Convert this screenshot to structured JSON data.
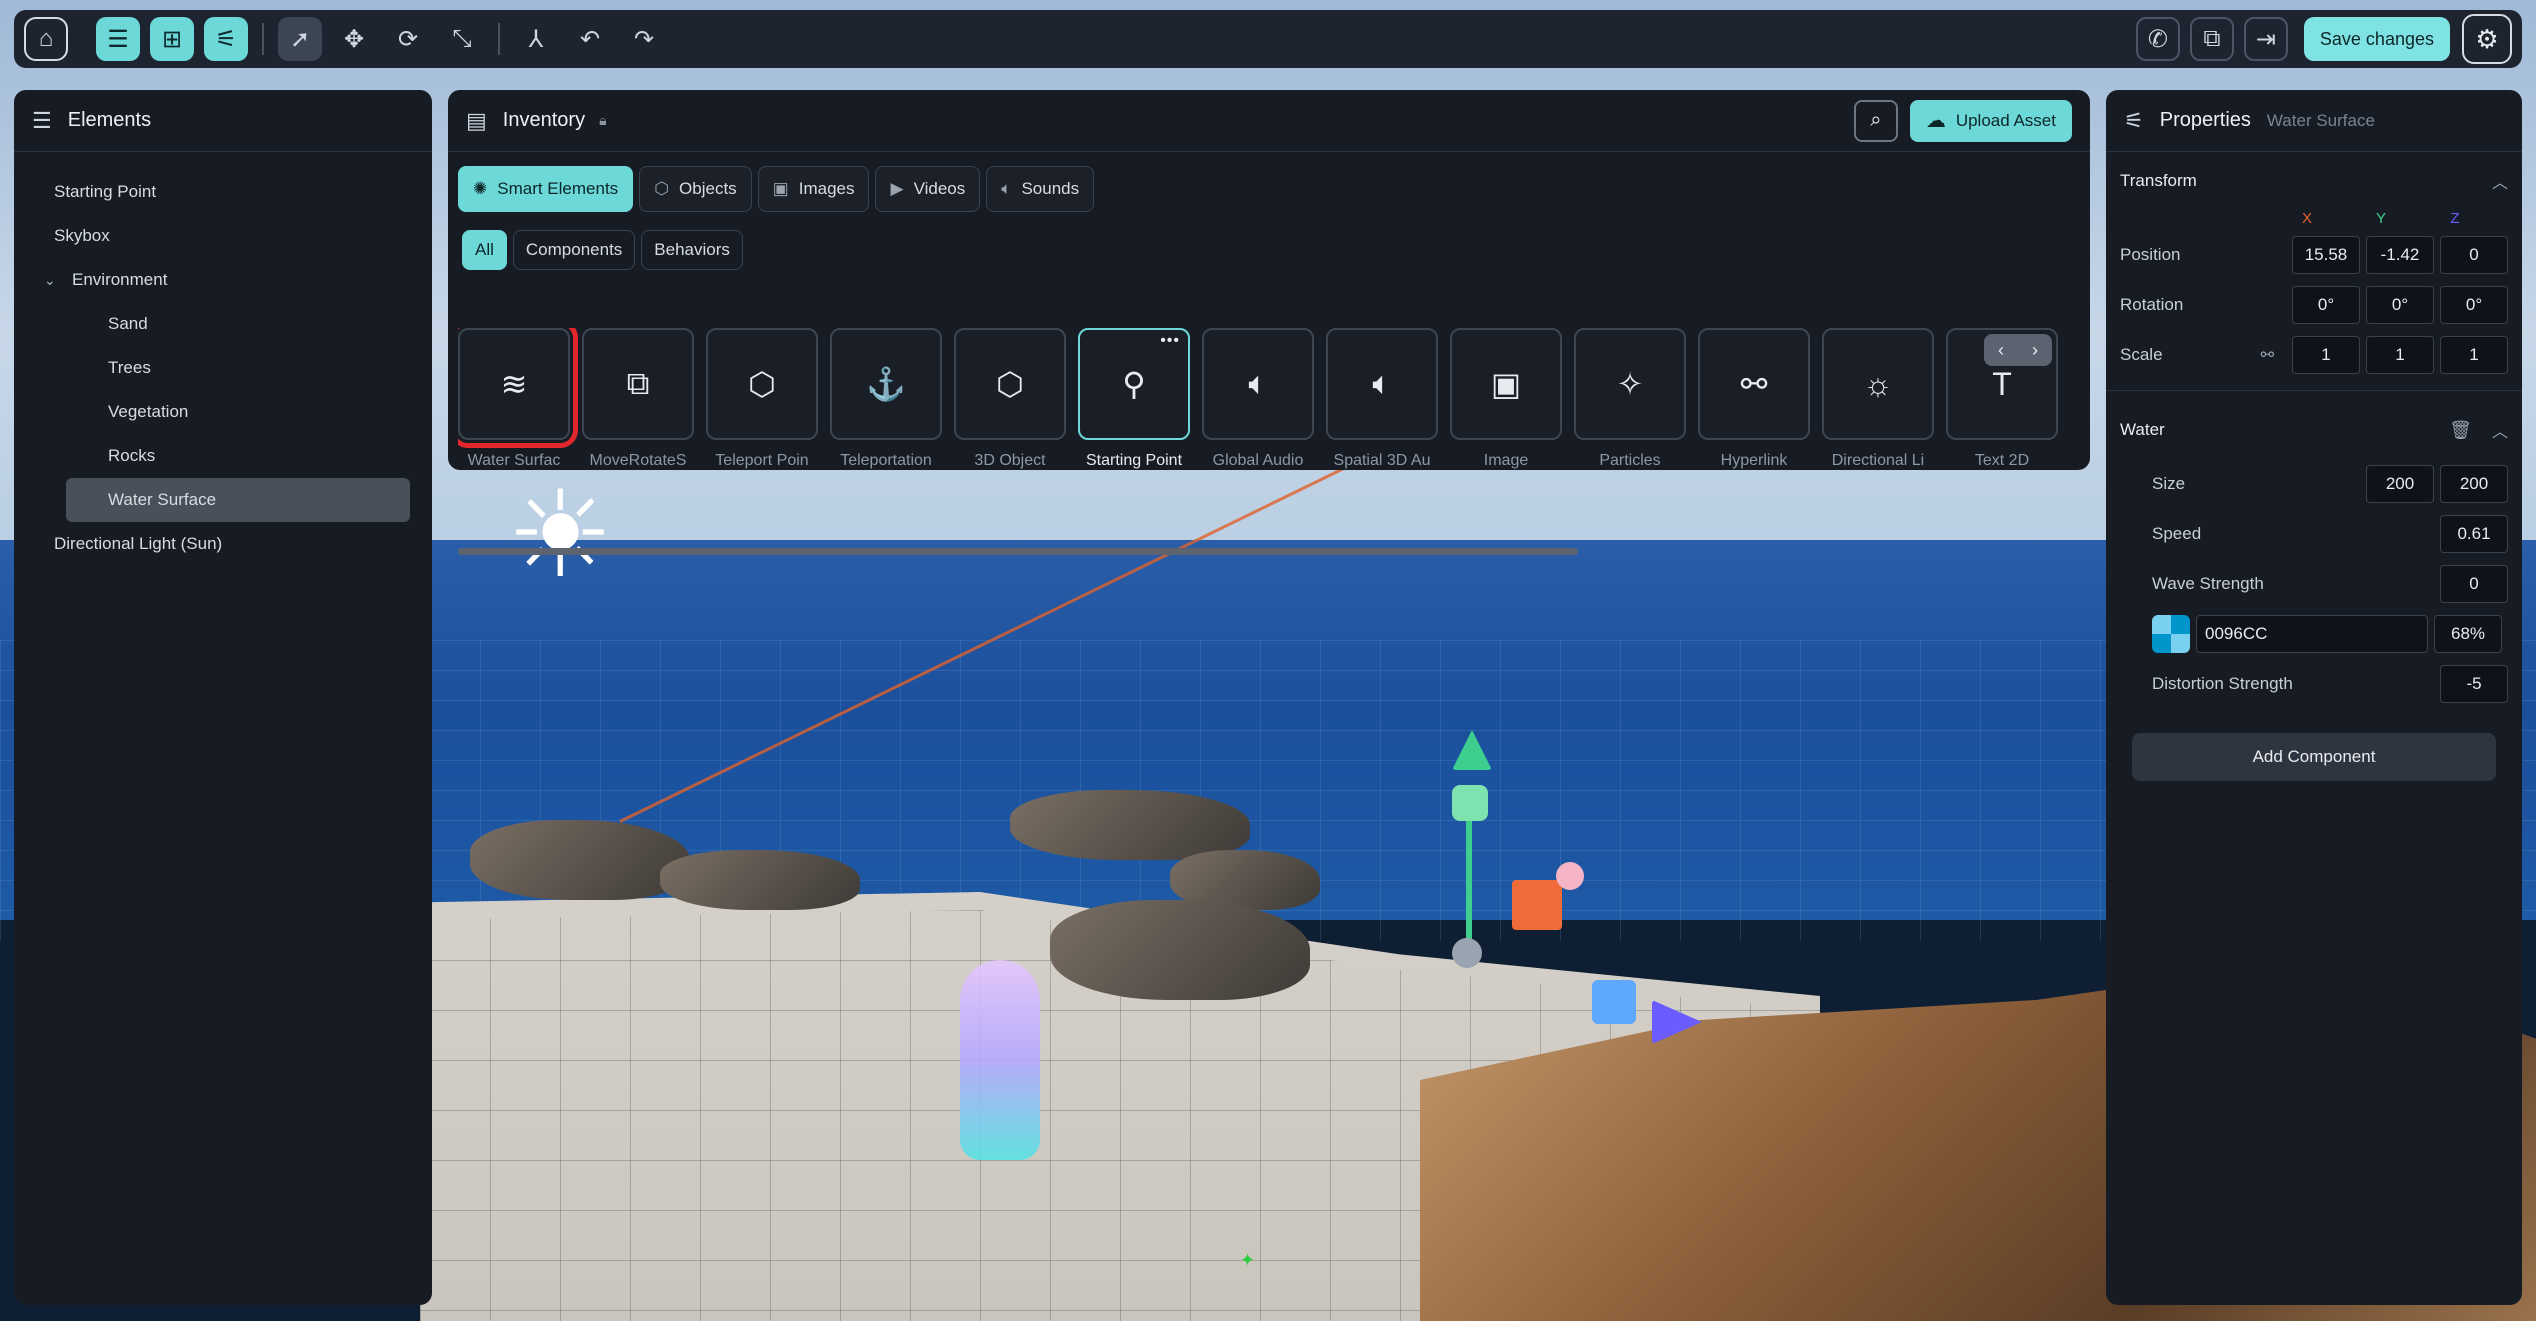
{
  "toolbar": {
    "save_label": "Save changes"
  },
  "elements_panel": {
    "title": "Elements",
    "items": [
      {
        "label": "Starting Point"
      },
      {
        "label": "Skybox"
      },
      {
        "label": "Environment"
      },
      {
        "label": "Sand"
      },
      {
        "label": "Trees"
      },
      {
        "label": "Vegetation"
      },
      {
        "label": "Rocks"
      },
      {
        "label": "Water Surface"
      },
      {
        "label": "Directional Light (Sun)"
      }
    ]
  },
  "inventory": {
    "title": "Inventory",
    "upload_label": "Upload Asset",
    "tabs": [
      {
        "label": "Smart Elements"
      },
      {
        "label": "Objects"
      },
      {
        "label": "Images"
      },
      {
        "label": "Videos"
      },
      {
        "label": "Sounds"
      }
    ],
    "filters": [
      {
        "label": "All"
      },
      {
        "label": "Components"
      },
      {
        "label": "Behaviors"
      }
    ],
    "cards": [
      {
        "label": "Water Surfac",
        "icon": "≋"
      },
      {
        "label": "MoveRotateS",
        "icon": "⧉"
      },
      {
        "label": "Teleport Poin",
        "icon": "⬡"
      },
      {
        "label": "Teleportation",
        "icon": "⚓"
      },
      {
        "label": "3D Object",
        "icon": "⬡"
      },
      {
        "label": "Starting Point",
        "icon": "⚲"
      },
      {
        "label": "Global Audio",
        "icon": "🔈"
      },
      {
        "label": "Spatial 3D Au",
        "icon": "🔈"
      },
      {
        "label": "Image",
        "icon": "▣"
      },
      {
        "label": "Particles",
        "icon": "✧"
      },
      {
        "label": "Hyperlink",
        "icon": "⚯"
      },
      {
        "label": "Directional Li",
        "icon": "☼"
      },
      {
        "label": "Text 2D",
        "icon": "T"
      }
    ]
  },
  "properties": {
    "title": "Properties",
    "subtitle": "Water Surface",
    "transform": {
      "title": "Transform",
      "axes": {
        "x": "X",
        "y": "Y",
        "z": "Z"
      },
      "position_label": "Position",
      "position": [
        "15.58",
        "-1.42",
        "0"
      ],
      "rotation_label": "Rotation",
      "rotation": [
        "0°",
        "0°",
        "0°"
      ],
      "scale_label": "Scale",
      "scale": [
        "1",
        "1",
        "1"
      ]
    },
    "water": {
      "title": "Water",
      "size_label": "Size",
      "size": [
        "200",
        "200"
      ],
      "speed_label": "Speed",
      "speed": "0.61",
      "wave_label": "Wave Strength",
      "wave": "0",
      "color_hex": "0096CC",
      "opacity": "68%",
      "distortion_label": "Distortion Strength",
      "distortion": "-5"
    },
    "add_component_label": "Add Component"
  },
  "colors": {
    "accent": "#6cd8d8",
    "selection_outline": "#e3262b",
    "axis_x": "#e8612c",
    "axis_y": "#3ecf8e",
    "axis_z": "#6a5cff"
  }
}
